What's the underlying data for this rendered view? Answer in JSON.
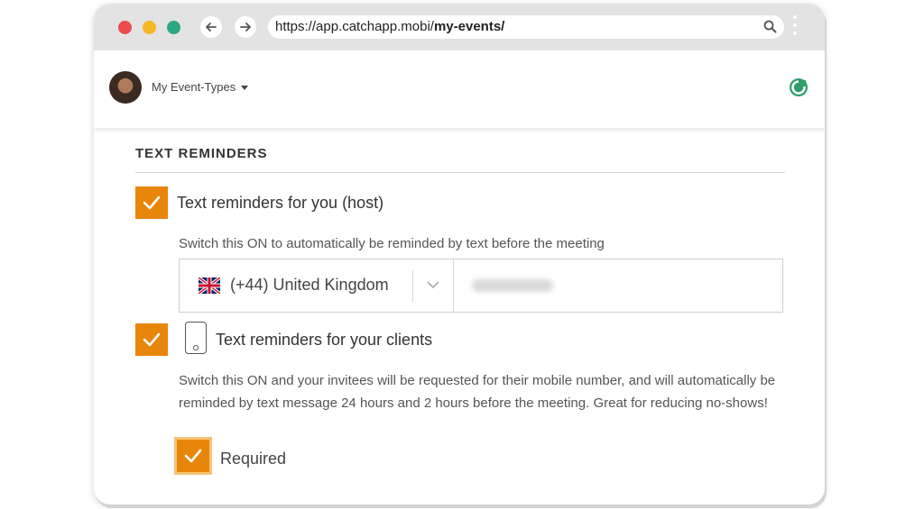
{
  "browser": {
    "url_prefix": "https://app.catchapp.mobi/",
    "url_path": "my-events/",
    "icons": [
      "back-arrow-icon",
      "forward-arrow-icon",
      "search-icon",
      "kebab-menu-icon"
    ]
  },
  "header": {
    "event_types_label": "My Event-Types",
    "brand_icon": "catchapp-logo-icon"
  },
  "section": {
    "title": "TEXT REMINDERS",
    "host_reminder": {
      "label": "Text reminders for you (host)",
      "checked": true,
      "hint": "Switch this ON to automatically be reminded by text before the meeting"
    },
    "phone": {
      "country": "(+44) United Kingdom",
      "flag": "uk-flag-icon"
    },
    "client_reminder": {
      "label": "Text reminders for your clients",
      "checked": true,
      "description": "Switch this ON and your invitees will be requested for their mobile number, and will automatically be reminded by text message 24 hours and 2 hours before the meeting. Great for reducing no-shows!"
    },
    "required": {
      "label": "Required",
      "checked": true
    }
  },
  "colors": {
    "accent": "#e8860b",
    "chrome": "#e3e3e3"
  }
}
